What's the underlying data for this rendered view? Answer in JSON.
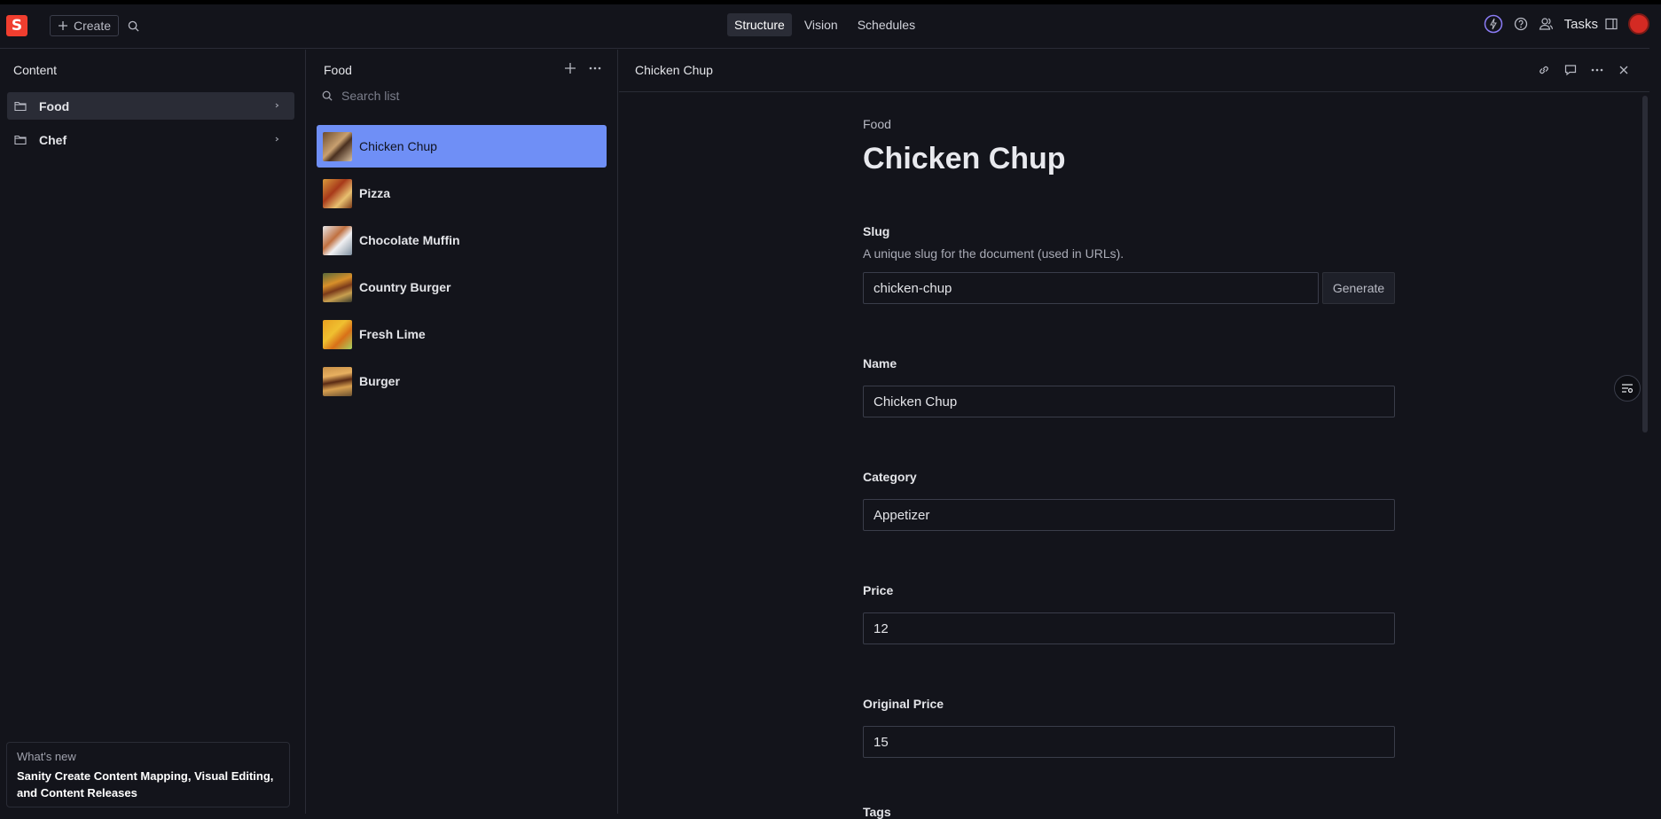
{
  "app": {
    "logo_letter": "S",
    "brand_color": "#f03e2f"
  },
  "navbar": {
    "create_label": "Create",
    "tabs": [
      {
        "label": "Structure",
        "active": true
      },
      {
        "label": "Vision",
        "active": false
      },
      {
        "label": "Schedules",
        "active": false
      }
    ],
    "tasks_label": "Tasks"
  },
  "content_pane": {
    "title": "Content",
    "items": [
      {
        "label": "Food",
        "selected": true
      },
      {
        "label": "Chef",
        "selected": false
      }
    ],
    "whats_new": {
      "label": "What's new",
      "text": "Sanity Create Content Mapping, Visual Editing, and Content Releases"
    }
  },
  "food_pane": {
    "title": "Food",
    "search_placeholder": "Search list",
    "items": [
      {
        "label": "Chicken Chup",
        "selected": true
      },
      {
        "label": "Pizza",
        "selected": false
      },
      {
        "label": "Chocolate Muffin",
        "selected": false
      },
      {
        "label": "Country Burger",
        "selected": false
      },
      {
        "label": "Fresh Lime",
        "selected": false
      },
      {
        "label": "Burger",
        "selected": false
      }
    ]
  },
  "document": {
    "header_title": "Chicken Chup",
    "type_label": "Food",
    "title": "Chicken Chup",
    "fields": {
      "slug": {
        "label": "Slug",
        "description": "A unique slug for the document (used in URLs).",
        "value": "chicken-chup",
        "button": "Generate"
      },
      "name": {
        "label": "Name",
        "value": "Chicken Chup"
      },
      "category": {
        "label": "Category",
        "value": "Appetizer"
      },
      "price": {
        "label": "Price",
        "value": "12"
      },
      "original_price": {
        "label": "Original Price",
        "value": "15"
      },
      "tags": {
        "label": "Tags"
      }
    }
  },
  "colors": {
    "accent_selected": "#6f8ff6",
    "background": "#13141b",
    "avatar": "#d42a23"
  }
}
